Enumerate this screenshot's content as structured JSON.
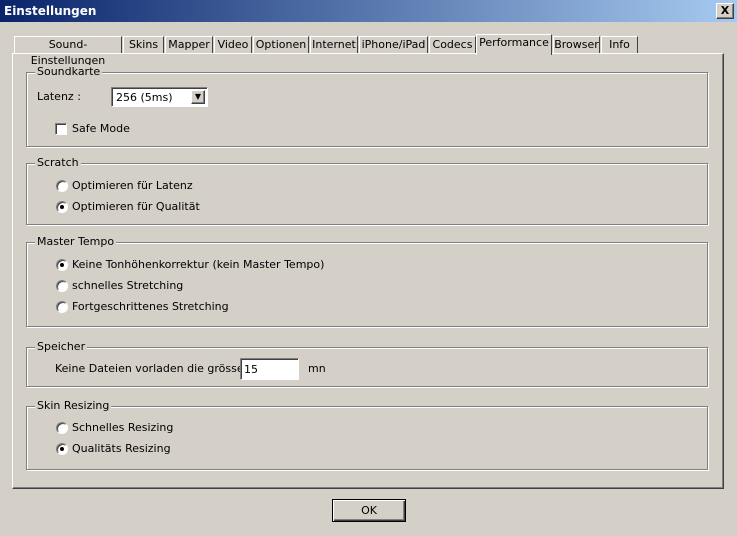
{
  "window": {
    "title": "Einstellungen",
    "close_glyph": "X"
  },
  "tabs": [
    {
      "label": "Sound-Einstellungen"
    },
    {
      "label": "Skins"
    },
    {
      "label": "Mapper"
    },
    {
      "label": "Video"
    },
    {
      "label": "Optionen"
    },
    {
      "label": "Internet"
    },
    {
      "label": "iPhone/iPad"
    },
    {
      "label": "Codecs"
    },
    {
      "label": "Performance",
      "active": true
    },
    {
      "label": "Browser"
    },
    {
      "label": "Info"
    }
  ],
  "soundkarte": {
    "title": "Soundkarte",
    "latenz_label": "Latenz :",
    "latenz_value": "256 (5ms)",
    "safe_mode_label": "Safe Mode",
    "safe_mode_checked": false
  },
  "scratch": {
    "title": "Scratch",
    "options": [
      {
        "label": "Optimieren für Latenz",
        "checked": false
      },
      {
        "label": "Optimieren für Qualität",
        "checked": true
      }
    ]
  },
  "master_tempo": {
    "title": "Master Tempo",
    "options": [
      {
        "label": "Keine Tonhöhenkorrektur (kein Master Tempo)",
        "checked": true
      },
      {
        "label": "schnelles Stretching",
        "checked": false
      },
      {
        "label": "Fortgeschrittenes Stretching",
        "checked": false
      }
    ]
  },
  "speicher": {
    "title": "Speicher",
    "label": "Keine Dateien vorladen die grösser",
    "value": "15",
    "unit": "mn"
  },
  "skin_resizing": {
    "title": "Skin Resizing",
    "options": [
      {
        "label": "Schnelles Resizing",
        "checked": false
      },
      {
        "label": "Qualitäts Resizing",
        "checked": true
      }
    ]
  },
  "ok_label": "OK",
  "colors": {
    "title_start": "#0a246a",
    "title_end": "#a6caf0",
    "face": "#d4d0c8"
  }
}
